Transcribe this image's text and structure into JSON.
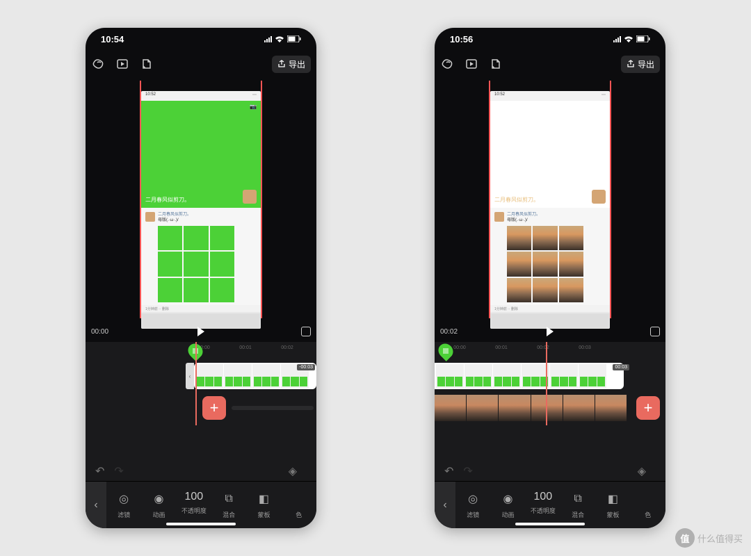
{
  "watermark": "什么值得买",
  "watermark_badge": "值",
  "phones": [
    {
      "status_time": "10:54",
      "export": "导出",
      "preview_time": "00:00",
      "hero_caption": "二月春风似剪刀。",
      "chat_title": "二月春风似剪刀。",
      "chat_sub": "母版(.·ω·.)/",
      "meta": "1分钟前  ··  删除",
      "shot_time": "10:52",
      "ruler": [
        "00:00",
        "00:01",
        "00:02"
      ],
      "clip_dur": "-00:03",
      "tools": [
        {
          "name": "filter",
          "label": "滤镜",
          "icon": "◎"
        },
        {
          "name": "anim",
          "label": "动画",
          "icon": "◉"
        },
        {
          "name": "opacity",
          "label": "不透明度",
          "value": "100"
        },
        {
          "name": "blend",
          "label": "混合",
          "icon": "⧉"
        },
        {
          "name": "mask",
          "label": "蒙板",
          "icon": "◧"
        },
        {
          "name": "color",
          "label": "色",
          "icon": ""
        }
      ]
    },
    {
      "status_time": "10:56",
      "export": "导出",
      "preview_time": "00:02",
      "hero_caption": "二月春风似剪刀。",
      "chat_title": "二月春风似剪刀。",
      "chat_sub": "母版(.·ω·.)/",
      "meta": "1分钟前  ··  删除",
      "shot_time": "10:52",
      "ruler": [
        "00:00",
        "00:01",
        "00:02",
        "00:03"
      ],
      "clip_dur": "00:03",
      "tools": [
        {
          "name": "filter",
          "label": "滤镜",
          "icon": "◎"
        },
        {
          "name": "anim",
          "label": "动画",
          "icon": "◉"
        },
        {
          "name": "opacity",
          "label": "不透明度",
          "value": "100"
        },
        {
          "name": "blend",
          "label": "混合",
          "icon": "⧉"
        },
        {
          "name": "mask",
          "label": "蒙板",
          "icon": "◧"
        },
        {
          "name": "color",
          "label": "色",
          "icon": ""
        }
      ]
    }
  ]
}
